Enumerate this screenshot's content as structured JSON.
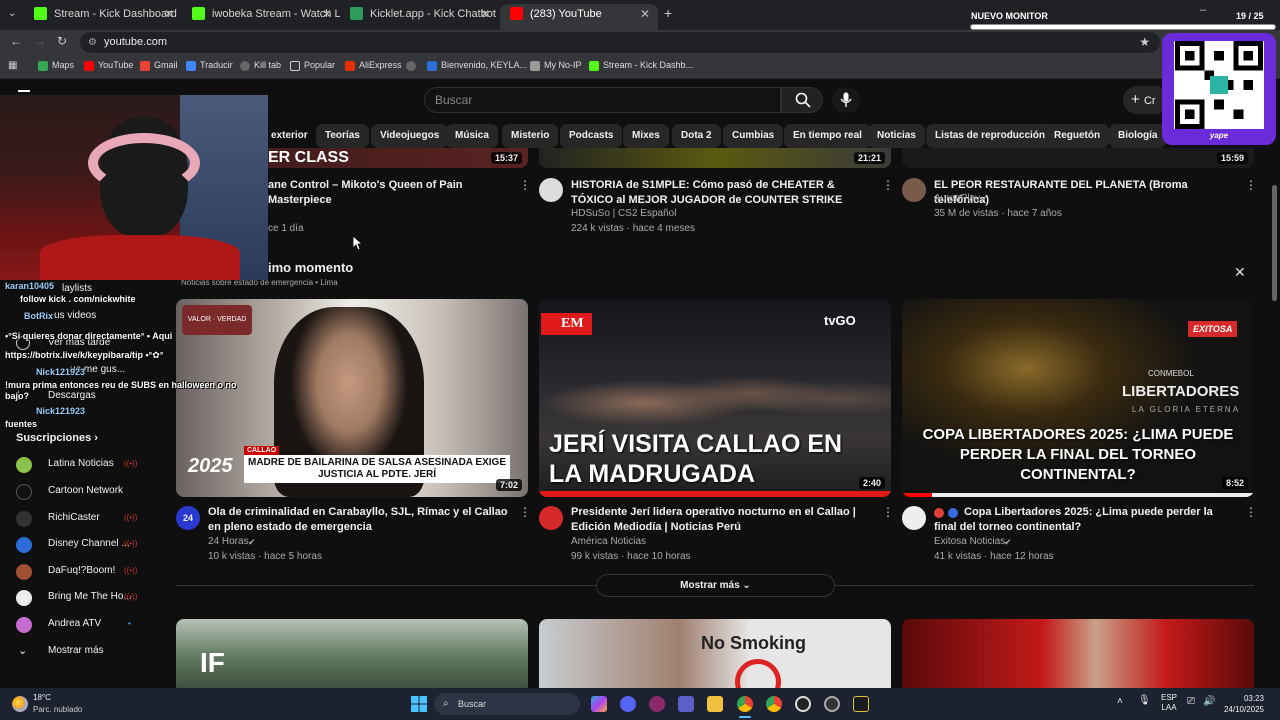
{
  "browser": {
    "tabs": [
      {
        "title": "Stream - Kick Dashboard",
        "color": "#53fc18"
      },
      {
        "title": "iwobeka Stream - Watch Live o",
        "color": "#53fc18"
      },
      {
        "title": "Kicklet.app - Kick Chatbot and",
        "color": "#2e9c5a"
      },
      {
        "title": "(283) YouTube",
        "color": "#ff0000"
      }
    ],
    "address": "youtube.com",
    "bookmarks": [
      "Maps",
      "YouTube",
      "Gmail",
      "Traducir",
      "Kill tab",
      "Popular",
      "AliExpress",
      "Bienvenido, KEYLA...",
      "My No-IP",
      "Stream - Kick Dashb..."
    ],
    "overlay_monitor": "NUEVO MONITOR",
    "overlay_count": "19 / 25"
  },
  "youtube": {
    "search_placeholder": "Buscar",
    "create_label": "Cr",
    "chips": [
      "exterior",
      "Teorías",
      "Videojuegos",
      "Música",
      "Misterio",
      "Podcasts",
      "Mixes",
      "Dota 2",
      "Cumbias",
      "En tiempo real",
      "Noticias",
      "Listas de reproducción",
      "Reguetón",
      "Biología"
    ],
    "top_row": [
      {
        "duration": "15:37",
        "title": "ane Control – Mikoto's Queen of Pain Masterpiece",
        "meta": "ce 1 día"
      },
      {
        "duration": "21:21",
        "title": "HISTORIA de S1MPLE: Cómo pasó de CHEATER & TÓXICO al MEJOR JUGADOR de COUNTER STRIKE",
        "channel": "HDSuSo | CS2 Español",
        "meta": "224 k vistas · hace 4 meses"
      },
      {
        "duration": "15:59",
        "title": "EL PEOR RESTAURANTE DEL PLANETA (Broma telefónica)",
        "channel": "AuronPlay",
        "meta": "35 M de vistas · hace 7 años"
      }
    ],
    "section_title": "imo momento",
    "section_subtitle": "Noticias sobre estado de emergencia • Lima",
    "news": [
      {
        "duration": "7:02",
        "thumb_caption": "MADRE DE BAILARINA DE SALSA ASESINADA EXIGE JUSTICIA AL PDTE. JERÍ",
        "thumb_tag": "CALLAO",
        "thumb_year": "2025",
        "title": "Ola de criminalidad en Carabayllo, SJL, Rímac y el Callao en pleno estado de emergencia",
        "channel": "24 Horas",
        "meta": "10 k vistas · hace 5 horas"
      },
      {
        "duration": "2:40",
        "thumb_caption": "JERÍ VISITA CALLAO EN LA MADRUGADA",
        "thumb_tag": "EM",
        "thumb_brand": "tvGO",
        "title": "Presidente Jerí lidera operativo nocturno en el Callao | Edición Mediodía | Noticias Perú",
        "channel": "América Noticias",
        "meta": "99 k vistas · hace 10 horas"
      },
      {
        "duration": "8:52",
        "thumb_caption": "COPA LIBERTADORES 2025: ¿LIMA PUEDE PERDER LA FINAL DEL TORNEO CONTINENTAL?",
        "thumb_tag": "EXITOSA",
        "thumb_brand": "LIBERTADORES",
        "thumb_sub": "LA GLORIA ETERNA",
        "thumb_conmebol": "CONMEBOL",
        "title": "Copa Libertadores 2025: ¿Lima puede perder la final del torneo continental?",
        "channel": "Exitosa Noticias",
        "meta": "41 k vistas · hace 12 horas"
      }
    ],
    "show_more": "Mostrar más",
    "bottom_row_labels": [
      "IF",
      "No Smoking"
    ],
    "sidebar": {
      "partial_items": [
        "laylists",
        "us videos",
        "Ver más tarde",
        "ue me gus...",
        "Descargas"
      ],
      "subscriptions_title": "Suscripciones",
      "subscriptions": [
        {
          "name": "Latina Noticias",
          "color": "#8bc34a"
        },
        {
          "name": "Cartoon Network",
          "color": "#111111"
        },
        {
          "name": "RichiCaster",
          "color": "#333333"
        },
        {
          "name": "Disney Channel ...",
          "color": "#2e6bd6"
        },
        {
          "name": "DaFuq!?Boom!",
          "color": "#a05030"
        },
        {
          "name": "Bring Me The Ho...",
          "color": "#eeeeee"
        },
        {
          "name": "Andrea ATV",
          "color": "#c76bd0"
        }
      ],
      "show_more": "Mostrar más"
    }
  },
  "chat": [
    {
      "user": "karan10405",
      "text": "",
      "color": "#9ad2ff"
    },
    {
      "user": "",
      "text": "follow kick . com/nickwhite",
      "color": "#ffffff"
    },
    {
      "user": "BotRix",
      "text": "",
      "color": "#9ad2ff"
    },
    {
      "user": "",
      "text": "•°Si quieres donar directamente° • Aqui",
      "color": "#ffffff"
    },
    {
      "user": "",
      "text": "https://botrix.live/k/keypibara/tip •°✿°",
      "color": "#ffffff"
    },
    {
      "user": "Nick121923",
      "text": "",
      "color": "#9ad2ff"
    },
    {
      "user": "",
      "text": "!mura prima entonces reu de SUBS en halloween o no",
      "color": "#ffffff"
    },
    {
      "user": "",
      "text": "bajo?",
      "color": "#ffffff"
    },
    {
      "user": "Nick121923",
      "text": "",
      "color": "#9ad2ff"
    },
    {
      "user": "",
      "text": "fuentes",
      "color": "#ffffff"
    }
  ],
  "taskbar": {
    "weather_temp": "18°C",
    "weather_desc": "Parc. nublado",
    "search_placeholder": "Buscar",
    "lang": "ESP",
    "lang_sub": "LAA",
    "time": "03:23",
    "date": "24/10/2025"
  },
  "qr_caption": "yape"
}
